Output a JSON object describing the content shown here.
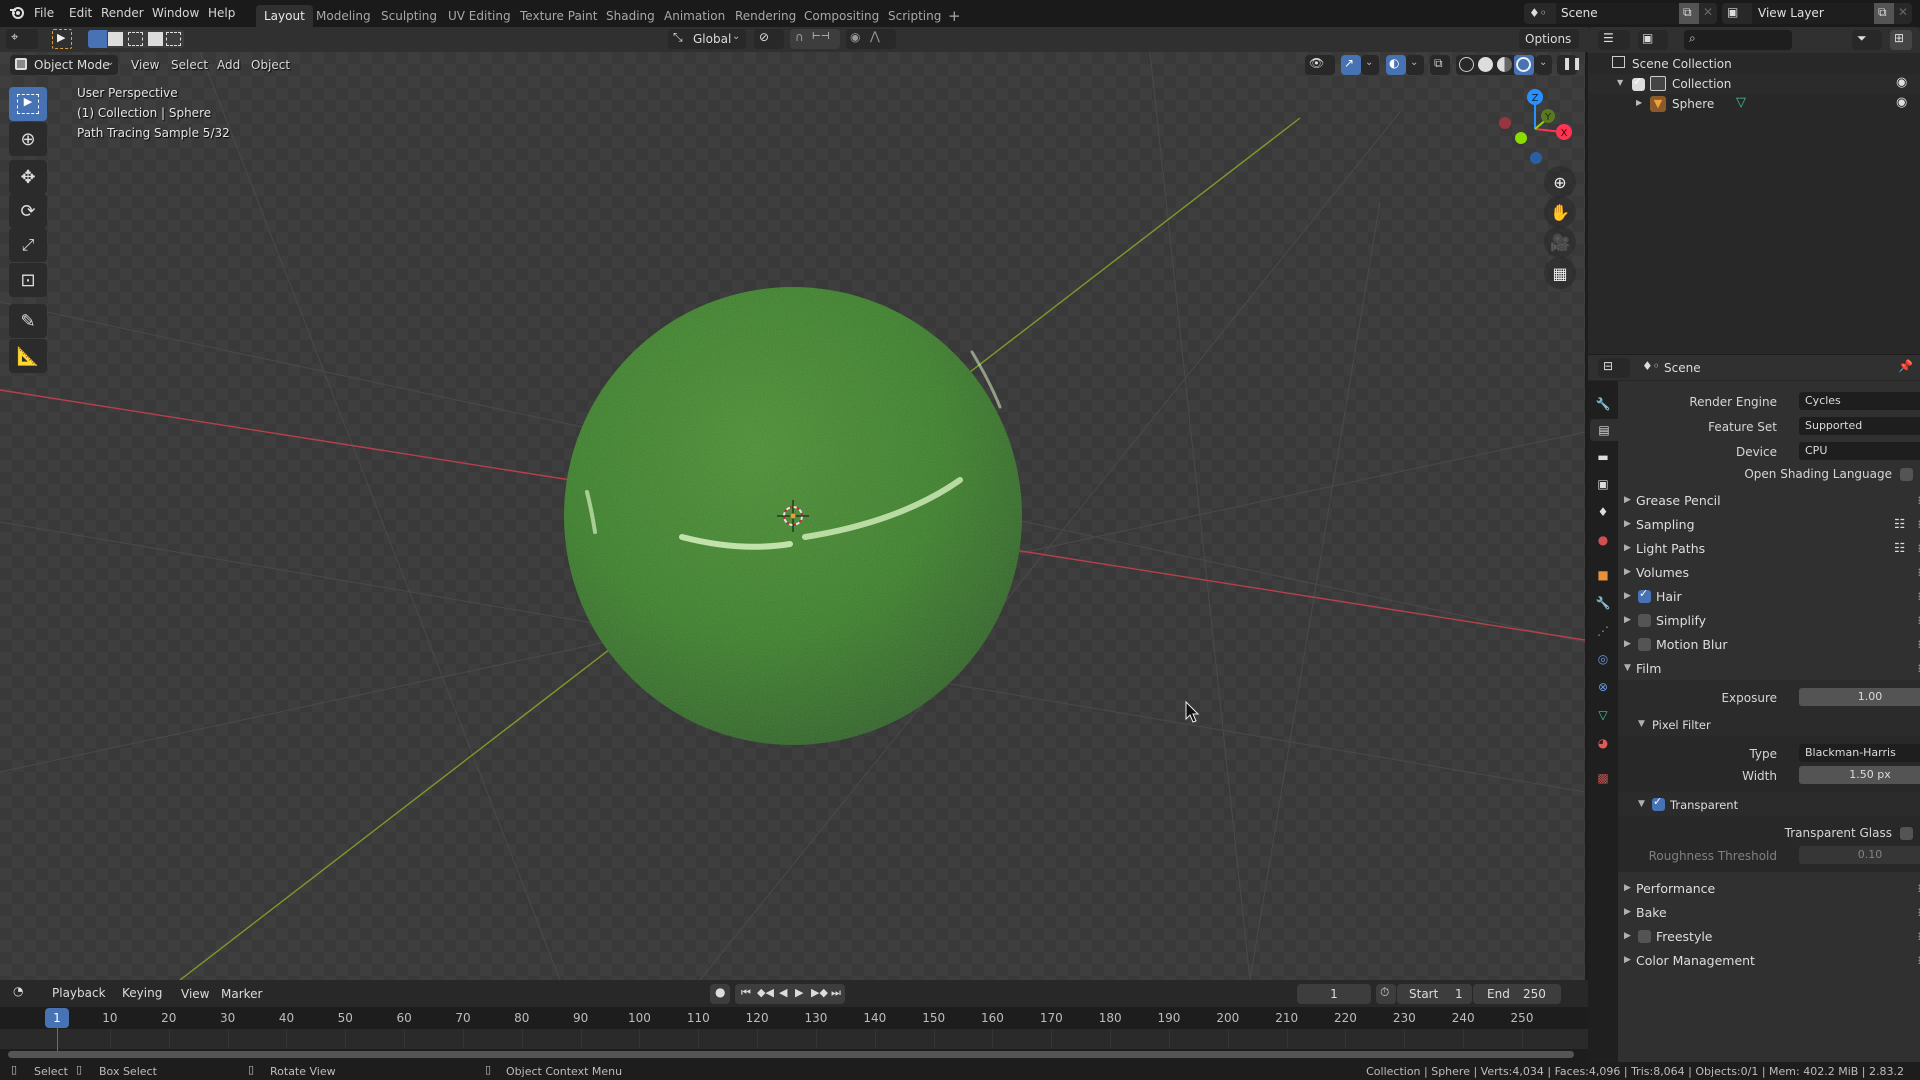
{
  "app": {
    "name": "Blender",
    "version": "2.83.2"
  },
  "topbar": {
    "menus": [
      "File",
      "Edit",
      "Render",
      "Window",
      "Help"
    ],
    "workspace_tabs": [
      {
        "label": "Layout",
        "active": true
      },
      {
        "label": "Modeling",
        "active": false
      },
      {
        "label": "Sculpting",
        "active": false
      },
      {
        "label": "UV Editing",
        "active": false
      },
      {
        "label": "Texture Paint",
        "active": false
      },
      {
        "label": "Shading",
        "active": false
      },
      {
        "label": "Animation",
        "active": false
      },
      {
        "label": "Rendering",
        "active": false
      },
      {
        "label": "Compositing",
        "active": false
      },
      {
        "label": "Scripting",
        "active": false
      }
    ],
    "add_workspace": "+",
    "scene_name": "Scene",
    "view_layer_name": "View Layer"
  },
  "header": {
    "mode": "Object Mode",
    "menus": [
      "View",
      "Select",
      "Add",
      "Object"
    ],
    "transform_orientation": "Global",
    "options_label": "Options"
  },
  "viewport": {
    "overlay_lines": [
      "User Perspective",
      "(1) Collection | Sphere",
      "Path Tracing Sample 5/32"
    ],
    "gizmo_axes": {
      "x": "X",
      "y": "Y",
      "z": "Z"
    },
    "axis_colors": {
      "x": "#ff3352",
      "y": "#8bdc00",
      "z": "#2890ff"
    },
    "object_color": "#3a7a22",
    "tools": [
      "select-box",
      "cursor",
      "move",
      "rotate",
      "scale",
      "transform",
      "annotate",
      "measure"
    ]
  },
  "outliner": {
    "search_placeholder": "",
    "root": "Scene Collection",
    "items": [
      {
        "label": "Collection",
        "checked": true,
        "visible": true
      },
      {
        "label": "Sphere",
        "visible": true
      }
    ]
  },
  "properties": {
    "context": "Scene",
    "render_engine": {
      "label": "Render Engine",
      "value": "Cycles"
    },
    "feature_set": {
      "label": "Feature Set",
      "value": "Supported"
    },
    "device": {
      "label": "Device",
      "value": "CPU"
    },
    "osl": {
      "label": "Open Shading Language",
      "checked": false
    },
    "panels": [
      {
        "label": "Grease Pencil",
        "open": false
      },
      {
        "label": "Sampling",
        "open": false,
        "presets": true
      },
      {
        "label": "Light Paths",
        "open": false,
        "presets": true
      },
      {
        "label": "Volumes",
        "open": false
      },
      {
        "label": "Hair",
        "open": false,
        "checkbox": true,
        "checked": true
      },
      {
        "label": "Simplify",
        "open": false,
        "checkbox": true,
        "checked": false
      },
      {
        "label": "Motion Blur",
        "open": false,
        "checkbox": true,
        "checked": false
      },
      {
        "label": "Film",
        "open": true
      }
    ],
    "film": {
      "exposure": {
        "label": "Exposure",
        "value": "1.00"
      },
      "pixel_filter": {
        "label": "Pixel Filter",
        "type": {
          "label": "Type",
          "value": "Blackman-Harris"
        },
        "width": {
          "label": "Width",
          "value": "1.50 px"
        }
      },
      "transparent": {
        "label": "Transparent",
        "checked": true,
        "transparent_glass": {
          "label": "Transparent Glass",
          "checked": false
        },
        "roughness_threshold": {
          "label": "Roughness Threshold",
          "value": "0.10"
        }
      }
    },
    "panels_after": [
      {
        "label": "Performance",
        "open": false
      },
      {
        "label": "Bake",
        "open": false
      },
      {
        "label": "Freestyle",
        "open": false,
        "checkbox": true,
        "checked": false
      },
      {
        "label": "Color Management",
        "open": false
      }
    ]
  },
  "timeline": {
    "menus": [
      "Playback",
      "Keying",
      "View",
      "Marker"
    ],
    "current_frame": "1",
    "start_label": "Start",
    "start": "1",
    "end_label": "End",
    "end": "250",
    "ticks": [
      "10",
      "20",
      "30",
      "40",
      "50",
      "60",
      "70",
      "80",
      "90",
      "100",
      "110",
      "120",
      "130",
      "140",
      "150",
      "160",
      "170",
      "180",
      "190",
      "200",
      "210",
      "220",
      "230",
      "240",
      "250"
    ],
    "playhead": "1"
  },
  "statusbar": {
    "hints": [
      "Select",
      "Box Select",
      "Rotate View",
      "Object Context Menu"
    ],
    "stats": "Collection | Sphere | Verts:4,034 | Faces:4,096 | Tris:8,064 | Objects:0/1 | Mem: 402.2 MiB | 2.83.2"
  }
}
